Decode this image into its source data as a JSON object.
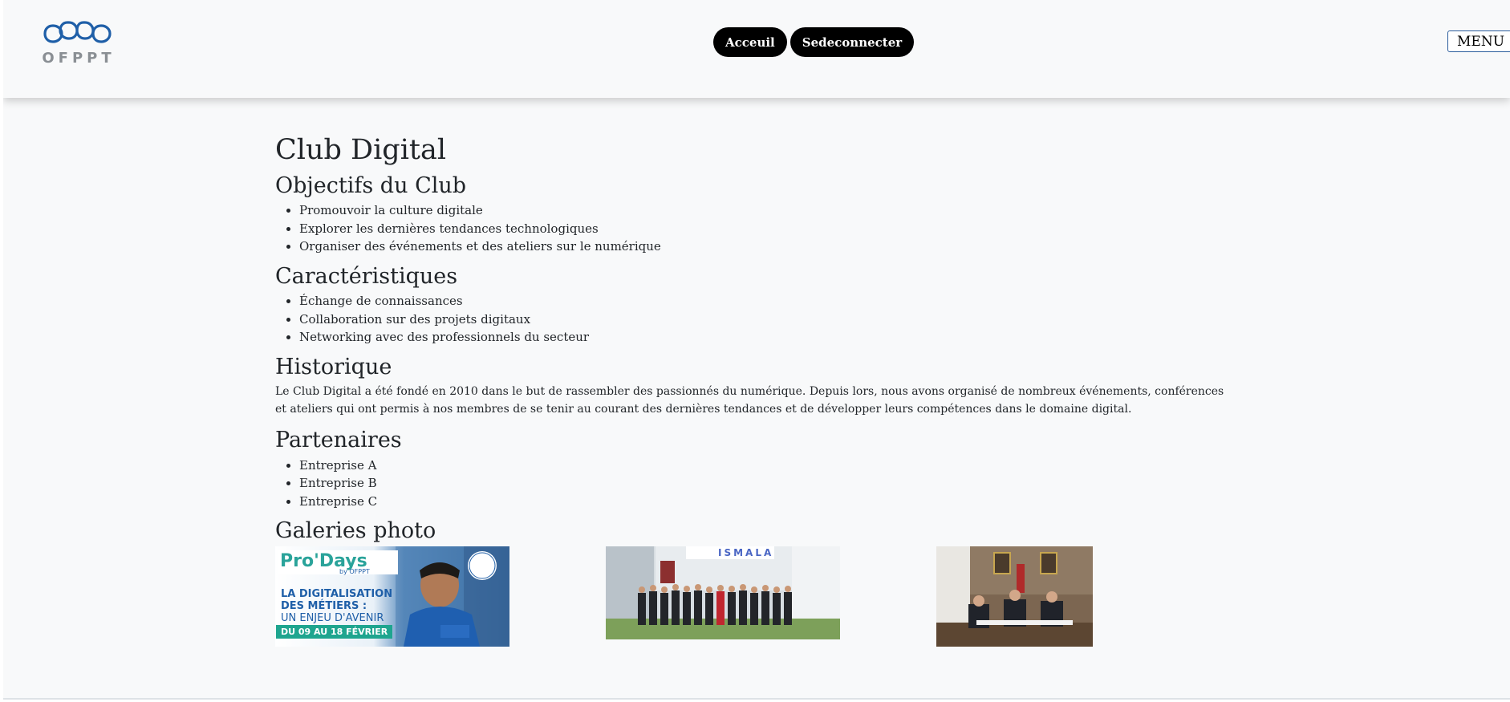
{
  "header": {
    "logo_text": "OFPPT",
    "nav": [
      {
        "label": "Acceuil"
      },
      {
        "label": "Sedeconnecter"
      }
    ],
    "menu_label": "MENU"
  },
  "page": {
    "title": "Club Digital",
    "sections": {
      "objectifs": {
        "heading": "Objectifs du Club",
        "items": [
          "Promouvoir la culture digitale",
          "Explorer les dernières tendances technologiques",
          "Organiser des événements et des ateliers sur le numérique"
        ]
      },
      "caracteristiques": {
        "heading": "Caractéristiques",
        "items": [
          "Échange de connaissances",
          "Collaboration sur des projets digitaux",
          "Networking avec des professionnels du secteur"
        ]
      },
      "historique": {
        "heading": "Historique",
        "text": "Le Club Digital a été fondé en 2010 dans le but de rassembler des passionnés du numérique. Depuis lors, nous avons organisé de nombreux événements, conférences et ateliers qui ont permis à nos membres de se tenir au courant des dernières tendances et de développer leurs compétences dans le domaine digital."
      },
      "partenaires": {
        "heading": "Partenaires",
        "items": [
          "Entreprise A",
          "Entreprise B",
          "Entreprise C"
        ]
      },
      "galeries": {
        "heading": "Galeries photo",
        "photo1": {
          "brand": "Pro'Days",
          "by": "by OFPPT",
          "line1": "LA DIGITALISATION",
          "line2": "DES MÉTIERS :",
          "line3": "UN ENJEU D'AVENIR",
          "dates": "DU 09 AU 18 FÉVRIER"
        },
        "photo2": {
          "sign": "ISMALA"
        }
      }
    }
  },
  "colors": {
    "background": "#f8f9fa",
    "nav_button": "#000000",
    "menu_border": "#2b5d9c",
    "logo_blue": "#1f5fa8"
  }
}
